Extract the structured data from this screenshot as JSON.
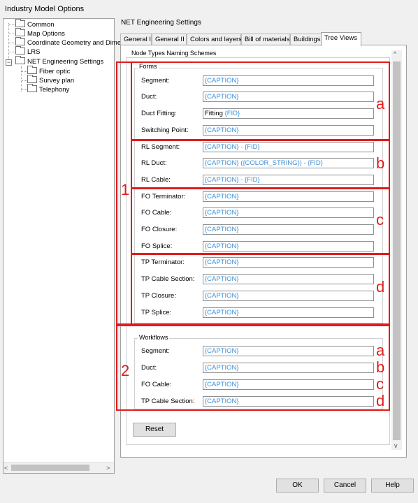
{
  "window": {
    "title": "Industry Model Options"
  },
  "tree": {
    "items": [
      {
        "label": "Common"
      },
      {
        "label": "Map Options"
      },
      {
        "label": "Coordinate Geometry and Dime"
      },
      {
        "label": "LRS"
      },
      {
        "label": "NET Engineering Settings"
      },
      {
        "label": "Fiber optic"
      },
      {
        "label": "Survey plan"
      },
      {
        "label": "Telephony"
      }
    ],
    "expanders": {
      "collapsed": "+",
      "expanded": "−"
    },
    "scroll_left": "<",
    "scroll_right": ">"
  },
  "panel": {
    "title": "NET Engineering Settings",
    "tabs": [
      {
        "label": "General I"
      },
      {
        "label": "General II"
      },
      {
        "label": "Colors and layers"
      },
      {
        "label": "Bill of materials"
      },
      {
        "label": "Buildings"
      },
      {
        "label": "Tree Views"
      }
    ],
    "active_tab": "Tree Views",
    "scroll_up": "^",
    "scroll_down": "v"
  },
  "naming": {
    "group_label": "Node Types Naming Schemes",
    "forms": {
      "label": "Forms",
      "fields": [
        {
          "label": "Segment:",
          "value": "{CAPTION}"
        },
        {
          "label": "Duct:",
          "value": "{CAPTION}"
        },
        {
          "label": "Duct Fitting:",
          "value_prefix": "Fitting ",
          "value": "{FID}"
        },
        {
          "label": "Switching Point:",
          "value": "{CAPTION}"
        },
        {
          "label": "RL Segment:",
          "value": "{CAPTION} - {FID}"
        },
        {
          "label": "RL Duct:",
          "value": "{CAPTION} ({COLOR_STRING}) - {FID}"
        },
        {
          "label": "RL Cable:",
          "value": "{CAPTION} - {FID}"
        },
        {
          "label": "FO Terminator:",
          "value": "{CAPTION}"
        },
        {
          "label": "FO Cable:",
          "value": "{CAPTION}"
        },
        {
          "label": "FO Closure:",
          "value": "{CAPTION}"
        },
        {
          "label": "FO Splice:",
          "value": "{CAPTION}"
        },
        {
          "label": "TP Terminator:",
          "value": "{CAPTION}"
        },
        {
          "label": "TP Cable Section:",
          "value": "{CAPTION}"
        },
        {
          "label": "TP Closure:",
          "value": "{CAPTION}"
        },
        {
          "label": "TP Splice:",
          "value": "{CAPTION}"
        }
      ]
    },
    "workflows": {
      "label": "Workflows",
      "fields": [
        {
          "label": "Segment:",
          "value": "{CAPTION}"
        },
        {
          "label": "Duct:",
          "value": "{CAPTION}"
        },
        {
          "label": "FO Cable:",
          "value": "{CAPTION}"
        },
        {
          "label": "TP Cable Section:",
          "value": "{CAPTION}"
        }
      ]
    },
    "reset_label": "Reset"
  },
  "annotations": {
    "color": "#e31b1b",
    "numbers": [
      "1",
      "2"
    ],
    "letters_forms": [
      "a",
      "b",
      "c",
      "d"
    ],
    "letters_workflows": [
      "a",
      "b",
      "c",
      "d"
    ]
  },
  "footer": {
    "ok": "OK",
    "cancel": "Cancel",
    "help": "Help"
  },
  "colors": {
    "placeholder_blue": "#3c8fd8",
    "annotation_red": "#e31b1b"
  }
}
